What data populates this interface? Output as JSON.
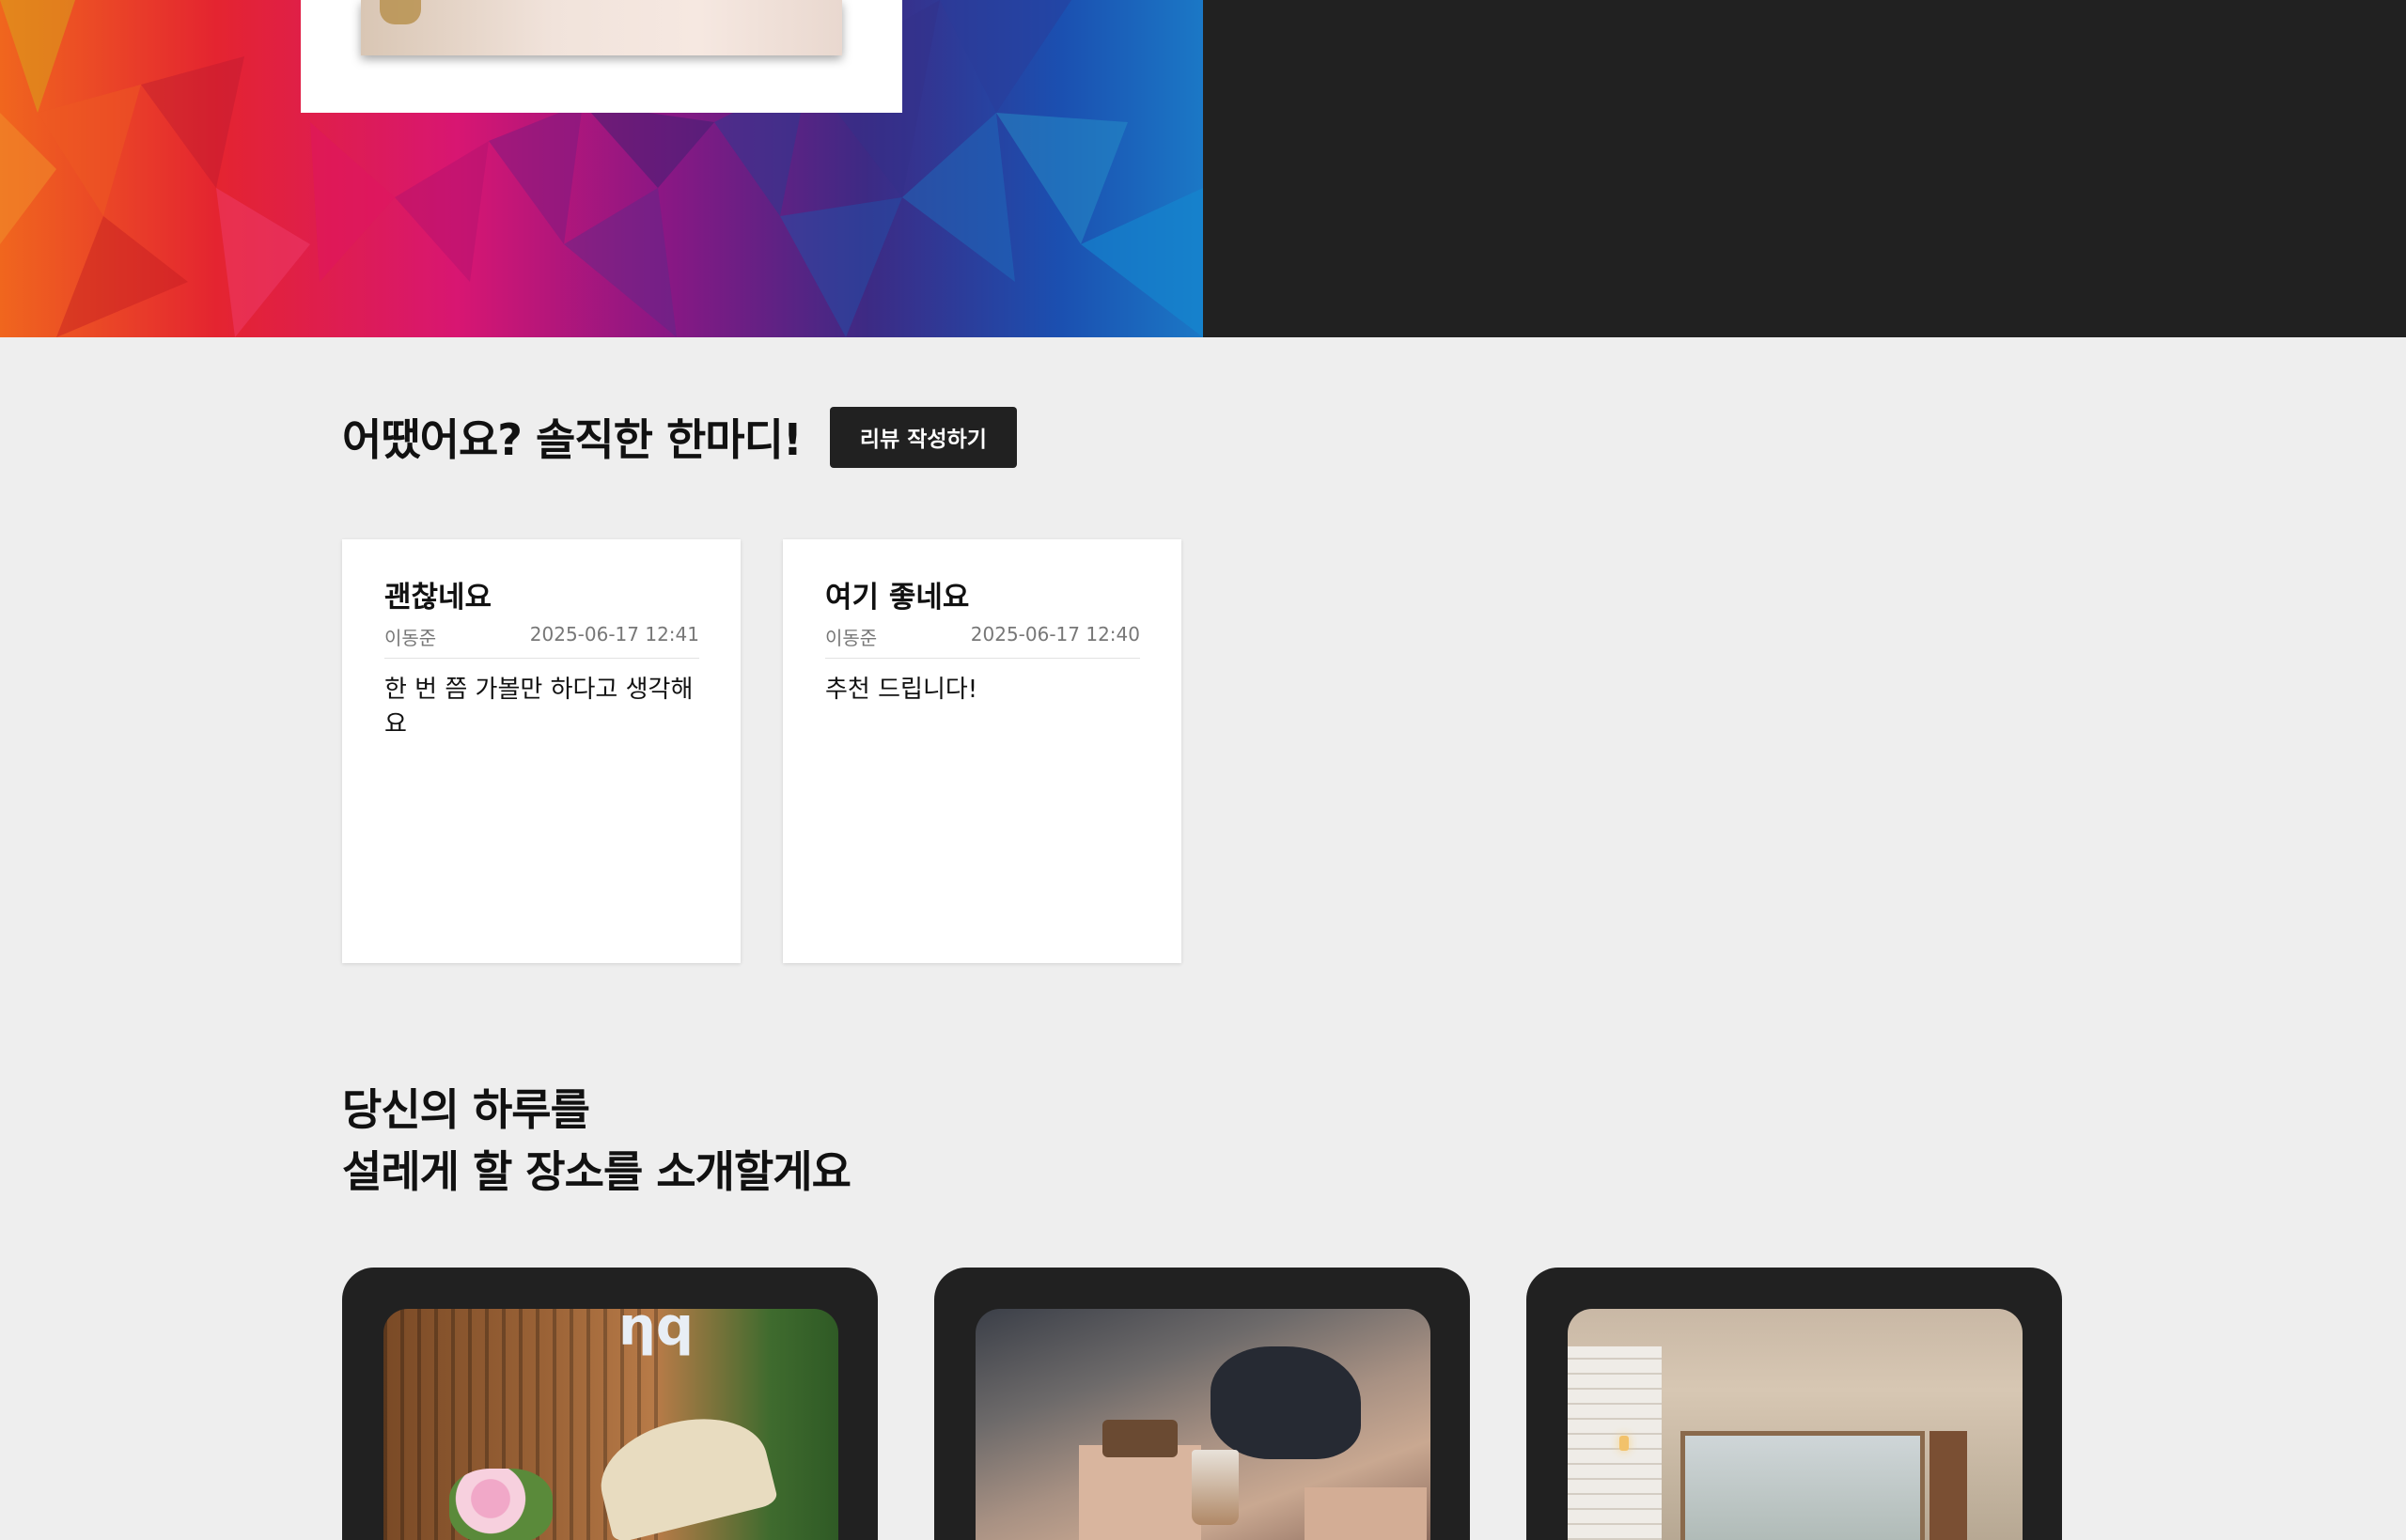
{
  "review": {
    "title": "어땠어요? 솔직한 한마디!",
    "write_button": "리뷰 작성하기",
    "cards": [
      {
        "title": "괜찮네요",
        "author": "이동준",
        "date": "2025-06-17 12:41",
        "body": "한 번 쯤 가볼만 하다고 생각해요"
      },
      {
        "title": "여기 좋네요",
        "author": "이동준",
        "date": "2025-06-17 12:40",
        "body": "추천 드립니다!"
      }
    ]
  },
  "places": {
    "title_line1": "당신의 하루를",
    "title_line2": "설레게 할 장소를 소개할게요"
  },
  "colors": {
    "page_bg": "#eeeeee",
    "dark": "#212121",
    "card_bg": "#ffffff"
  }
}
